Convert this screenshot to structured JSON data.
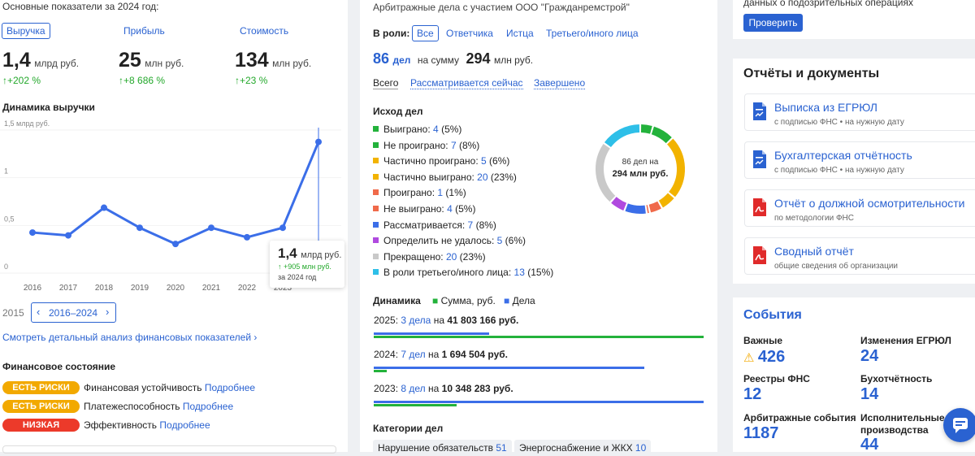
{
  "left": {
    "title": "Основные показатели за 2024 год:",
    "tabs": [
      "Выручка",
      "Прибыль",
      "Стоимость"
    ],
    "metrics": [
      {
        "value": "1,4",
        "unit": "млрд руб.",
        "delta": "+202 %"
      },
      {
        "value": "25",
        "unit": "млн руб.",
        "delta": "+8 686 %"
      },
      {
        "value": "134",
        "unit": "млн руб.",
        "delta": "+23 %"
      }
    ],
    "chart_title": "Динамика выручки",
    "range_start": "2015",
    "range_label": "2016–2024",
    "detail_link": "Смотреть детальный анализ финансовых показателей",
    "fin_title": "Финансовое состояние",
    "fin_rows": [
      {
        "badge": "ЕСТЬ РИСКИ",
        "label": "Финансовая устойчивость",
        "link": "Подробнее",
        "color": "#f2a900"
      },
      {
        "badge": "ЕСТЬ РИСКИ",
        "label": "Платежеспособность",
        "link": "Подробнее",
        "color": "#f2a900"
      },
      {
        "badge": "НИЗКАЯ",
        "label": "Эффективность",
        "link": "Подробнее",
        "color": "#ec3a2a"
      }
    ]
  },
  "chart_data": {
    "type": "line",
    "title": "Динамика выручки",
    "xlabel": "",
    "ylabel": "1,5 млрд руб.",
    "categories": [
      "2016",
      "2017",
      "2018",
      "2019",
      "2020",
      "2021",
      "2022",
      "2023",
      "2024"
    ],
    "y_ticks": [
      "1,5 млрд руб.",
      "1",
      "0,5",
      "0"
    ],
    "series": [
      {
        "values": [
          0.4,
          0.37,
          0.66,
          0.45,
          0.28,
          0.45,
          0.35,
          0.45,
          1.35
        ]
      }
    ],
    "ylim": [
      0,
      1.5
    ],
    "color": "#3b6ee8",
    "tooltip": {
      "value": "1,4",
      "unit": "млрд руб.",
      "delta": "+905 млн руб.",
      "period": "за 2024 год"
    }
  },
  "mid": {
    "title": "Арбитражные дела с участием ООО \"Гражданремстрой\"",
    "role_label": "В роли:",
    "roles": [
      "Все",
      "Ответчика",
      "Истца",
      "Третьего/иного лица"
    ],
    "count": "86",
    "count_unit": "дел",
    "sum_prefix": "на сумму",
    "sum": "294",
    "sum_unit": "млн руб.",
    "filters": [
      "Всего",
      "Рассматривается сейчас",
      "Завершено"
    ],
    "outcome_title": "Исход дел",
    "outcomes": [
      {
        "label": "Выиграно:",
        "n": "4",
        "pct": "(5%)",
        "color": "#23b23b"
      },
      {
        "label": "Не проиграно:",
        "n": "7",
        "pct": "(8%)",
        "color": "#23b23b"
      },
      {
        "label": "Частично проиграно:",
        "n": "5",
        "pct": "(6%)",
        "color": "#f2b300"
      },
      {
        "label": "Частично выиграно:",
        "n": "20",
        "pct": "(23%)",
        "color": "#f2b300"
      },
      {
        "label": "Проиграно:",
        "n": "1",
        "pct": "(1%)",
        "color": "#f06a4a"
      },
      {
        "label": "Не выиграно:",
        "n": "4",
        "pct": "(5%)",
        "color": "#f06a4a"
      },
      {
        "label": "Рассматривается:",
        "n": "7",
        "pct": "(8%)",
        "color": "#3b6ee8"
      },
      {
        "label": "Определить не удалось:",
        "n": "5",
        "pct": "(6%)",
        "color": "#b04adf"
      },
      {
        "label": "Прекращено:",
        "n": "20",
        "pct": "(23%)",
        "color": "#c9c9c9"
      },
      {
        "label": "В роли третьего/иного лица:",
        "n": "13",
        "pct": "(15%)",
        "color": "#2ebfe8"
      }
    ],
    "donut_line1": "86 дел на",
    "donut_line2": "294 млн руб.",
    "dyn_title": "Динамика",
    "dyn_legend": [
      "Сумма, руб.",
      "Дела"
    ],
    "dyn_rows": [
      {
        "year": "2025:",
        "cases": "3 дела",
        "on": "на",
        "sum": "41 803 166 руб.",
        "sum_frac": 1.0,
        "cases_frac": 0.35
      },
      {
        "year": "2024:",
        "cases": "7 дел",
        "on": "на",
        "sum": "1 694 504 руб.",
        "sum_frac": 0.04,
        "cases_frac": 0.82
      },
      {
        "year": "2023:",
        "cases": "8 дел",
        "on": "на",
        "sum": "10 348 283 руб.",
        "sum_frac": 0.25,
        "cases_frac": 1.0
      }
    ],
    "cat_title": "Категории дел",
    "categories": [
      {
        "label": "Нарушение обязательств",
        "n": "51"
      },
      {
        "label": "Энергоснабжение и ЖКХ",
        "n": "10"
      }
    ]
  },
  "right": {
    "top_text": "данных о подозрительных операциях",
    "check_button": "Проверить",
    "docs_title": "Отчёты и документы",
    "docs": [
      {
        "title": "Выписка из ЕГРЮЛ",
        "sub": "с подписью ФНС • на нужную дату",
        "icon": "doc-icon",
        "color": "#2a62d1"
      },
      {
        "title": "Бухгалтерская отчётность",
        "sub": "с подписью ФНС • на нужную дату",
        "icon": "doc-icon",
        "color": "#2a62d1"
      },
      {
        "title": "Отчёт о должной осмотрительности",
        "sub": "по методологии ФНС",
        "icon": "pdf-icon",
        "color": "#e02a2a"
      },
      {
        "title": "Сводный отчёт",
        "sub": "общие сведения об организации",
        "icon": "pdf-icon",
        "color": "#e02a2a"
      }
    ],
    "events_title": "События",
    "events": [
      {
        "label": "Важные",
        "value": "426"
      },
      {
        "label": "Изменения ЕГРЮЛ",
        "value": "24"
      },
      {
        "label": "Реестры ФНС",
        "value": "12"
      },
      {
        "label": "Бухотчётность",
        "value": "14"
      },
      {
        "label": "Арбитражные события",
        "value": "1187"
      },
      {
        "label": "Исполнительные производства",
        "value": "44"
      }
    ]
  }
}
